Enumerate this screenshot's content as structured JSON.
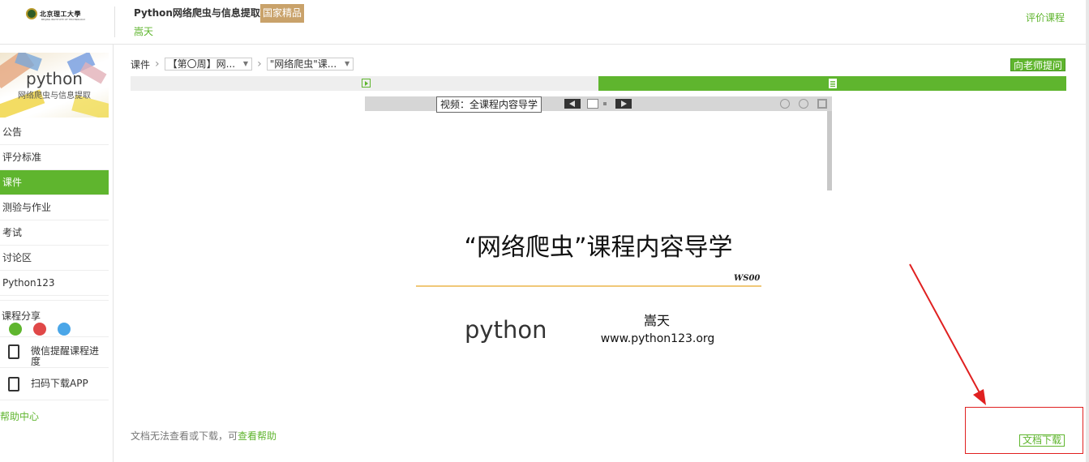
{
  "header": {
    "university": "北京理工大學",
    "university_sub": "BEIJING INSTITUTE OF TECHNOLOGY",
    "course_title": "Python网络爬虫与信息提取",
    "badge": "国家精品",
    "teacher": "嵩天",
    "rate_link": "评价课程"
  },
  "sidebar": {
    "banner_title": "python",
    "banner_subtitle": "网络爬虫与信息提取",
    "items": [
      {
        "label": "公告",
        "active": false
      },
      {
        "label": "评分标准",
        "active": false
      },
      {
        "label": "课件",
        "active": true
      },
      {
        "label": "测验与作业",
        "active": false
      },
      {
        "label": "考试",
        "active": false
      },
      {
        "label": "讨论区",
        "active": false
      },
      {
        "label": "Python123",
        "active": false
      }
    ],
    "share_label": "课程分享",
    "tools": [
      {
        "label": "微信提醒课程进度",
        "icon": "checklist-icon"
      },
      {
        "label": "扫码下载APP",
        "icon": "phone-icon"
      }
    ],
    "help": "帮助中心"
  },
  "breadcrumb": {
    "root": "课件",
    "week": "【第〇周】网...",
    "lesson": "\"网络爬虫\"课..."
  },
  "ask_teacher": "向老师提问",
  "viewer": {
    "tooltip": "视频：全课程内容导学",
    "slide_title": "“网络爬虫”课程内容导学",
    "slide_code": "WS00",
    "logo_text": "python",
    "author": "嵩天",
    "site": "www.python123.org"
  },
  "footer": {
    "note": "文档无法查看或下载，可",
    "help_link": "查看帮助",
    "download": "文档下载"
  },
  "colors": {
    "accent": "#5fb52e",
    "badge": "#c9a26a",
    "highlight_box": "#e02020"
  }
}
